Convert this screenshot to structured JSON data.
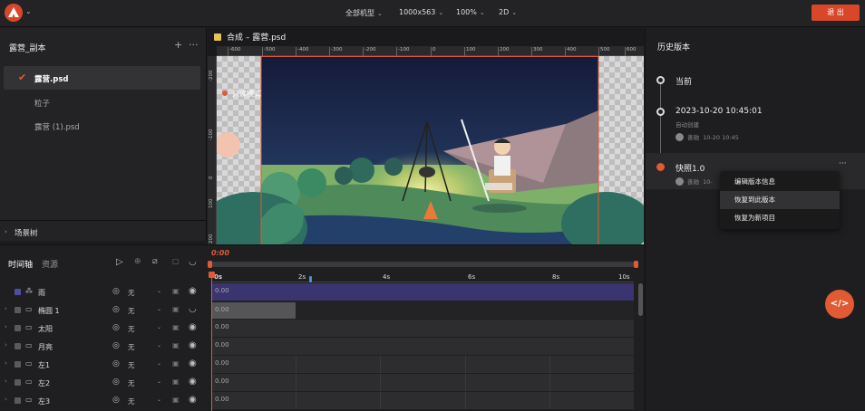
{
  "topbar": {
    "device": "全部机型",
    "resolution": "1000x563",
    "zoom": "100%",
    "mode": "2D",
    "exit_label": "退 出"
  },
  "left": {
    "title": "露营_副本",
    "files": [
      {
        "name": "露营.psd",
        "active": true
      },
      {
        "name": "粒子",
        "active": false
      },
      {
        "name": "露营 (1).psd",
        "active": false
      }
    ],
    "scene_tree": "场景树"
  },
  "canvas": {
    "tab_title": "合成 – 露营.psd",
    "readonly_label": "只读模式",
    "ruler_h": [
      "-600",
      "-500",
      "-400",
      "-300",
      "-200",
      "-100",
      "0",
      "100",
      "200",
      "300",
      "400",
      "500",
      "600"
    ],
    "ruler_v": [
      "-200",
      "-100",
      "0",
      "100",
      "200"
    ]
  },
  "history": {
    "title": "历史版本",
    "items": [
      {
        "label": "当前",
        "sub": "",
        "user": "",
        "time": ""
      },
      {
        "label": "2023-10-20 10:45:01",
        "sub": "自动创建",
        "user": "善驰",
        "time": "10-20  10:45"
      },
      {
        "label": "快照1.0",
        "sub": "",
        "user": "善驰",
        "time": "10-"
      }
    ],
    "more": "···",
    "context_menu": [
      "编辑版本信息",
      "恢复到此版本",
      "恢复为新项目"
    ]
  },
  "timeline": {
    "tabs": [
      "时间轴",
      "资源"
    ],
    "timecode": "0:00",
    "ticks": [
      "0s",
      "2s",
      "4s",
      "6s",
      "8s",
      "10s"
    ],
    "layers": [
      {
        "name": "雨",
        "blend": "无",
        "clip_label": "0.00",
        "color": "#4b4fa8"
      },
      {
        "name": "椭圆 1",
        "blend": "无",
        "clip_label": "0.00",
        "color": "#5a5a5c"
      },
      {
        "name": "太阳",
        "blend": "无",
        "clip_label": "0.00",
        "color": "#5a5a5c"
      },
      {
        "name": "月亮",
        "blend": "无",
        "clip_label": "0.00",
        "color": "#5a5a5c"
      },
      {
        "name": "左1",
        "blend": "无",
        "clip_label": "0.00",
        "color": "#5a5a5c"
      },
      {
        "name": "左2",
        "blend": "无",
        "clip_label": "0.00",
        "color": "#5a5a5c"
      },
      {
        "name": "左3",
        "blend": "无",
        "clip_label": "0.00",
        "color": "#5a5a5c"
      }
    ]
  },
  "icons": {
    "logo": "camp-logo-icon",
    "check": "✔",
    "play": "▷",
    "eye": "◉",
    "lock": "🔒"
  },
  "colors": {
    "accent": "#d9472b",
    "selected_layer": "#3a3470"
  }
}
